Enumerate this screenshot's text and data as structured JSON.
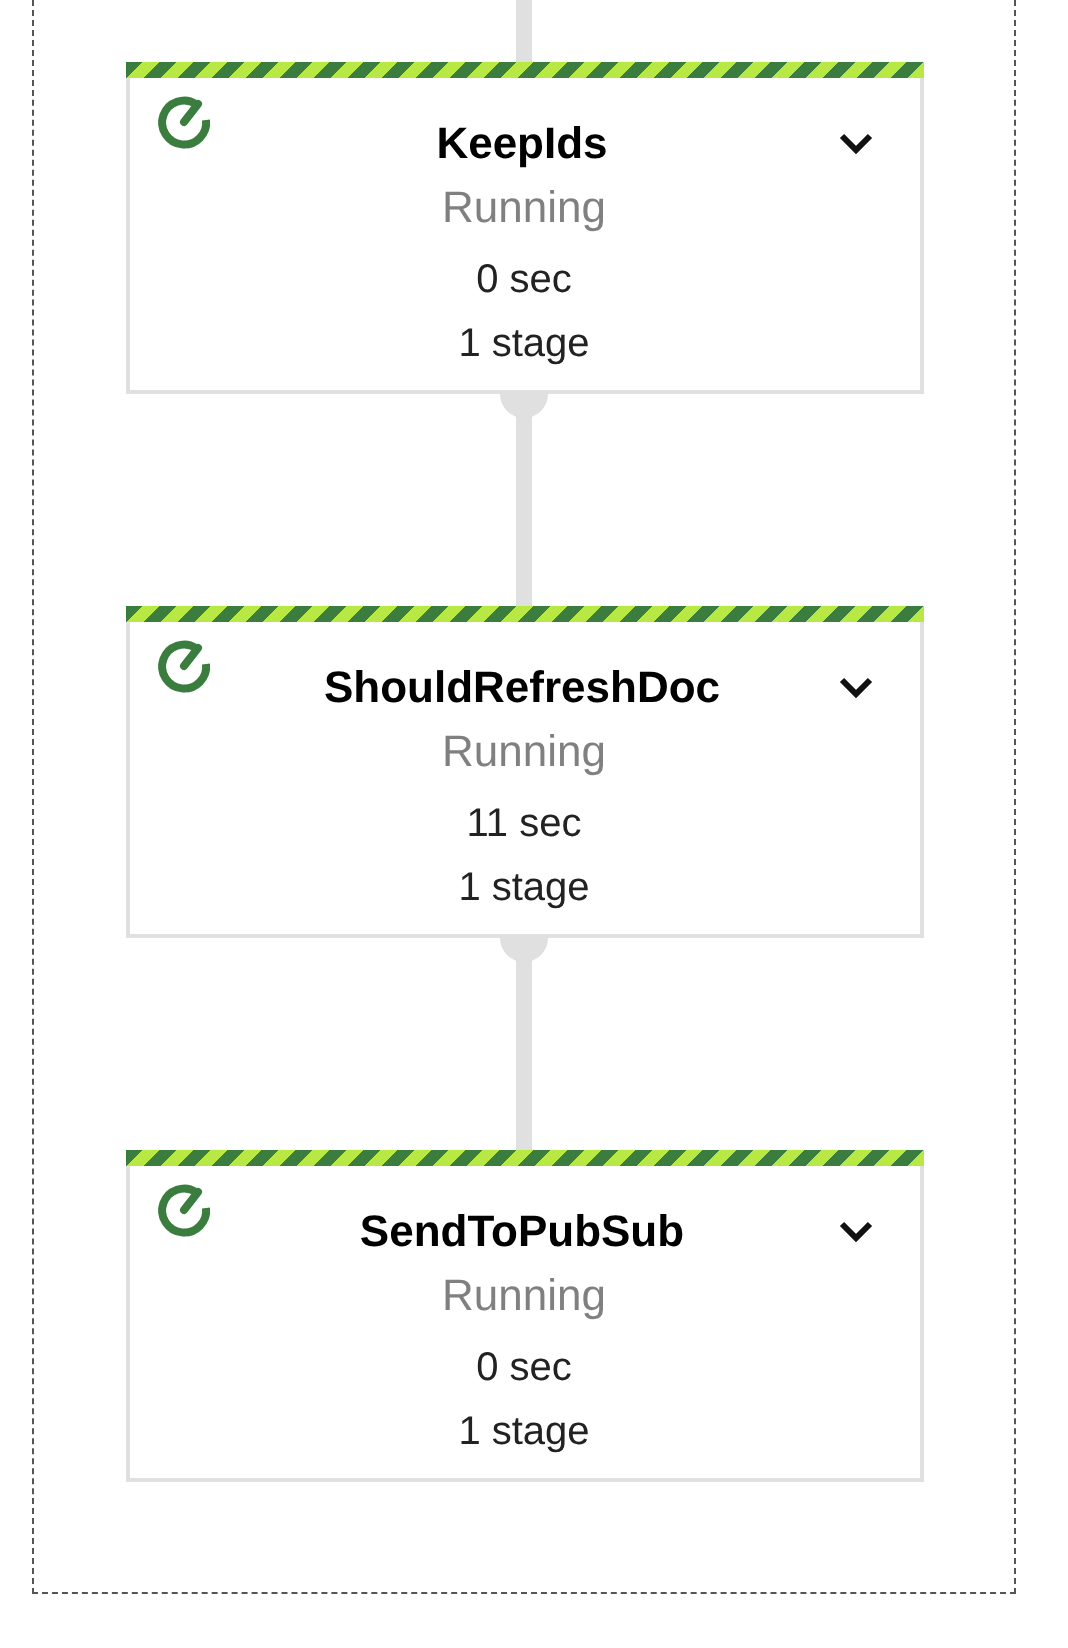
{
  "stages": [
    {
      "name": "KeepIds",
      "status": "Running",
      "duration": "0 sec",
      "stage_count": "1 stage"
    },
    {
      "name": "ShouldRefreshDoc",
      "status": "Running",
      "duration": "11 sec",
      "stage_count": "1 stage"
    },
    {
      "name": "SendToPubSub",
      "status": "Running",
      "duration": "0 sec",
      "stage_count": "1 stage"
    }
  ]
}
